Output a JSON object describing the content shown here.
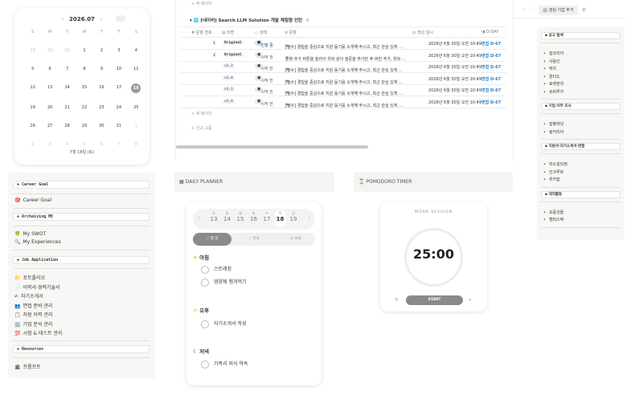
{
  "calendar": {
    "title": "2026.07",
    "prev": "‹",
    "next": "›",
    "day_headers": [
      "S",
      "M",
      "T",
      "W",
      "T",
      "F",
      "S"
    ],
    "rows": [
      [
        {
          "d": "28",
          "m": true
        },
        {
          "d": "29",
          "m": true
        },
        {
          "d": "30",
          "m": true
        },
        {
          "d": "1"
        },
        {
          "d": "2"
        },
        {
          "d": "3"
        },
        {
          "d": "4"
        }
      ],
      [
        {
          "d": "5"
        },
        {
          "d": "6"
        },
        {
          "d": "7"
        },
        {
          "d": "8"
        },
        {
          "d": "9"
        },
        {
          "d": "10"
        },
        {
          "d": "11"
        }
      ],
      [
        {
          "d": "12"
        },
        {
          "d": "13"
        },
        {
          "d": "14"
        },
        {
          "d": "15"
        },
        {
          "d": "16"
        },
        {
          "d": "17"
        },
        {
          "d": "18",
          "sel": true
        }
      ],
      [
        {
          "d": "19"
        },
        {
          "d": "20"
        },
        {
          "d": "21"
        },
        {
          "d": "22"
        },
        {
          "d": "23"
        },
        {
          "d": "24"
        },
        {
          "d": "25"
        }
      ],
      [
        {
          "d": "26"
        },
        {
          "d": "27"
        },
        {
          "d": "28"
        },
        {
          "d": "29"
        },
        {
          "d": "30"
        },
        {
          "d": "31"
        },
        {
          "d": "1",
          "m": true
        }
      ],
      [
        {
          "d": "2",
          "m": true
        },
        {
          "d": "3",
          "m": true
        },
        {
          "d": "4",
          "m": true
        },
        {
          "d": "5",
          "m": true
        },
        {
          "d": "6",
          "m": true
        },
        {
          "d": "7",
          "m": true
        },
        {
          "d": "8",
          "m": true
        }
      ]
    ],
    "footer": "7월 18일 (토)"
  },
  "sidebar": {
    "career_goal_header": "Career Goal",
    "career_goal": "Career Goal",
    "archiving_header": "Archeiving ME",
    "my_swot": "My SWOT",
    "my_experiences": "My Experiences",
    "job_header": "Job Application",
    "job_items": [
      "포트폴리오",
      "이력서·경력기술서",
      "자기소개서",
      "면접 준비·관리",
      "지원 이력 관리",
      "기업 분석 관리",
      "시험 & 테스트 관리"
    ],
    "resources_header": "Resources",
    "prompt": "프롬프트"
  },
  "table": {
    "new_page_top": "새 페이지",
    "group_title": "[네이버] Search LLM Solution 개발 체험형 인턴",
    "group_count": "6",
    "headers": {
      "num": "문항 번호",
      "ver": "버전",
      "state": "상태",
      "q": "문항",
      "date": "생성 일시",
      "dday": "D-DAY"
    },
    "rows": [
      {
        "num": "1",
        "ver": "Original",
        "state": "진행 중",
        "q": "[필수] 경험을 중심으로 지원 동기를 소개해 주시고, 최근 관심 있게 …",
        "date": "2026년 6월 30일 오전 10:49",
        "dday": "면접 D-67"
      },
      {
        "num": "2",
        "ver": "Original",
        "state": "시작 전",
        "q": "문항 추가 버튼을 눌러서 위와 같이 질문을 추가한 후 버전 추가, 위와 …",
        "date": "2026년 6월 30일 오전 10:49",
        "dday": "면접 D-67"
      },
      {
        "num": "",
        "ver": "v2.3",
        "state": "시작 전",
        "q": "[필수] 경험을 중심으로 지원 동기를 소개해 주시고, 최근 관심 있게 …",
        "date": "2026년 6월 30일 오전 10:49",
        "dday": "면접 D-67"
      },
      {
        "num": "",
        "ver": "v2.0",
        "state": "시작 전",
        "q": "[필수] 경험을 중심으로 지원 동기를 소개해 주시고, 최근 관심 있게 …",
        "date": "2026년 6월 30일 오전 10:49",
        "dday": "면접 D-67"
      },
      {
        "num": "",
        "ver": "v2.2",
        "state": "시작 전",
        "q": "[필수] 경험을 중심으로 지원 동기를 소개해 주시고, 최근 관심 있게 …",
        "date": "2026년 6월 30일 오전 10:49",
        "dday": "면접 D-67"
      },
      {
        "num": "",
        "ver": "v2.0",
        "state": "시작 전",
        "q": "[필수] 경험을 중심으로 지원 동기를 소개해 주시고, 최근 관심 있게 …",
        "date": "2026년 6월 30일 오전 10:49",
        "dday": "면접 D-67"
      }
    ],
    "new_page": "새 페이지",
    "new_group": "신규 그룹"
  },
  "planner": {
    "header": "DAILY PLANNER",
    "days": [
      {
        "w": "토",
        "d": "13"
      },
      {
        "w": "일",
        "d": "14"
      },
      {
        "w": "월",
        "d": "15"
      },
      {
        "w": "화",
        "d": "16"
      },
      {
        "w": "수",
        "d": "17"
      },
      {
        "w": "목",
        "d": "18"
      },
      {
        "w": "금",
        "d": "19"
      }
    ],
    "tabs": [
      "할 일",
      "완료",
      "보류"
    ],
    "sections": [
      {
        "label": "아침",
        "tasks": [
          "스트레칭",
          "영양제 챙겨먹기"
        ]
      },
      {
        "label": "오후",
        "tasks": [
          "자기소개서 작성"
        ]
      },
      {
        "label": "저녁",
        "tasks": [
          "가족과 외식 약속"
        ]
      }
    ]
  },
  "pomodoro": {
    "header": "POMODORO TIMER",
    "session": "WORK SESSION",
    "time": "25:00",
    "start": "START"
  },
  "right": {
    "add_button": "관심 기업 추가",
    "sections": [
      {
        "title": "공고 탐색",
        "items": [
          "잡코리아",
          "사람인",
          "캐치",
          "원티드",
          "로켓펀치",
          "슈퍼루키"
        ]
      },
      {
        "title": "기업·직무 조사",
        "items": [
          "잡플래닛",
          "링커리어"
        ]
      },
      {
        "title": "지원서·자기소개서·면접",
        "items": [
          "자소설닷컴",
          "인크루트",
          "위커잡"
        ]
      },
      {
        "title": "대외활동",
        "items": [
          "요즘것들",
          "캠퍼스픽"
        ]
      }
    ]
  }
}
